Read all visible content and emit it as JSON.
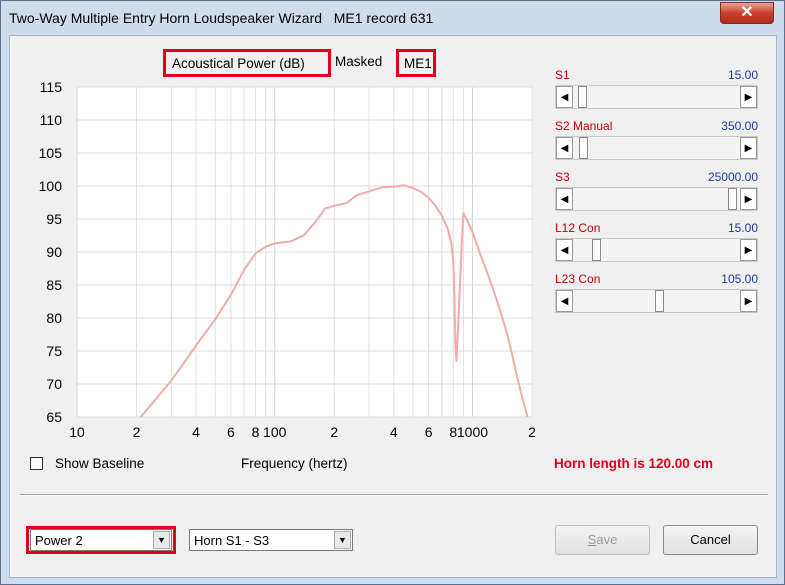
{
  "window": {
    "title": "Two-Way Multiple Entry Horn Loudspeaker Wizard   ME1 record 631",
    "close_glyph": "✕"
  },
  "chart_header": {
    "quantity": "Acoustical Power (dB)",
    "masked": "Masked",
    "record": "ME1"
  },
  "chart_data": {
    "type": "line",
    "xscale": "log",
    "x_ticks": [
      {
        "v": 10,
        "label": "10"
      },
      {
        "v": 20,
        "label": "2"
      },
      {
        "v": 40,
        "label": "4"
      },
      {
        "v": 60,
        "label": "6"
      },
      {
        "v": 80,
        "label": "8"
      },
      {
        "v": 100,
        "label": "100"
      },
      {
        "v": 200,
        "label": "2"
      },
      {
        "v": 400,
        "label": "4"
      },
      {
        "v": 600,
        "label": "6"
      },
      {
        "v": 800,
        "label": "8"
      },
      {
        "v": 1000,
        "label": "1000"
      },
      {
        "v": 2000,
        "label": "2"
      }
    ],
    "y_ticks": [
      115,
      110,
      105,
      100,
      95,
      90,
      85,
      80,
      75,
      70,
      65
    ],
    "xlim": [
      10,
      2000
    ],
    "ylim": [
      65,
      115
    ],
    "xlabel": "Frequency (hertz)",
    "line_color": "#f4aaaa",
    "series": [
      {
        "x": [
          21,
          30,
          40,
          50,
          60,
          70,
          80,
          90,
          100,
          120,
          140,
          160,
          180,
          200,
          230,
          260,
          300,
          350,
          400,
          450,
          500,
          550,
          600,
          650,
          700,
          750,
          780,
          800,
          810,
          820,
          830,
          850,
          880,
          900,
          950,
          1000,
          1100,
          1200,
          1300,
          1400,
          1500,
          1600,
          1700,
          1800,
          1900
        ],
        "y": [
          65,
          70.5,
          75.8,
          79.8,
          83.5,
          87.3,
          89.8,
          90.8,
          91.3,
          91.6,
          92.5,
          94.5,
          96.6,
          97.0,
          97.4,
          98.6,
          99.2,
          99.8,
          99.9,
          100.1,
          99.7,
          99.1,
          98.2,
          97.0,
          95.5,
          93.5,
          91.5,
          88.5,
          83.0,
          76.0,
          73.5,
          80.0,
          90.5,
          95.9,
          94.5,
          93.0,
          89.5,
          86.5,
          83.5,
          80.5,
          77.5,
          74.0,
          70.5,
          67.5,
          65.0
        ]
      }
    ],
    "grid": true,
    "background": "#ffffff"
  },
  "baseline": {
    "label": "Show Baseline",
    "checked": false
  },
  "horn_length": "Horn length is 120.00 cm",
  "sliders": [
    {
      "label": "S1",
      "value": "15.00",
      "pos": 0.03
    },
    {
      "label": "S2  Manual",
      "value": "350.00",
      "pos": 0.04
    },
    {
      "label": "S3",
      "value": "25000.00",
      "pos": 0.97
    },
    {
      "label": "L12  Con",
      "value": "15.00",
      "pos": 0.12
    },
    {
      "label": "L23  Con",
      "value": "105.00",
      "pos": 0.51
    }
  ],
  "power_select": {
    "value": "Power 2"
  },
  "horn_select": {
    "value": "Horn S1 - S3"
  },
  "buttons": {
    "save_prefix": "",
    "save_access": "S",
    "save_rest": "ave",
    "cancel": "Cancel"
  },
  "colors": {
    "accent_red": "#e0001b",
    "slider_label": "#c00000",
    "slider_value": "#1a3aa0"
  }
}
